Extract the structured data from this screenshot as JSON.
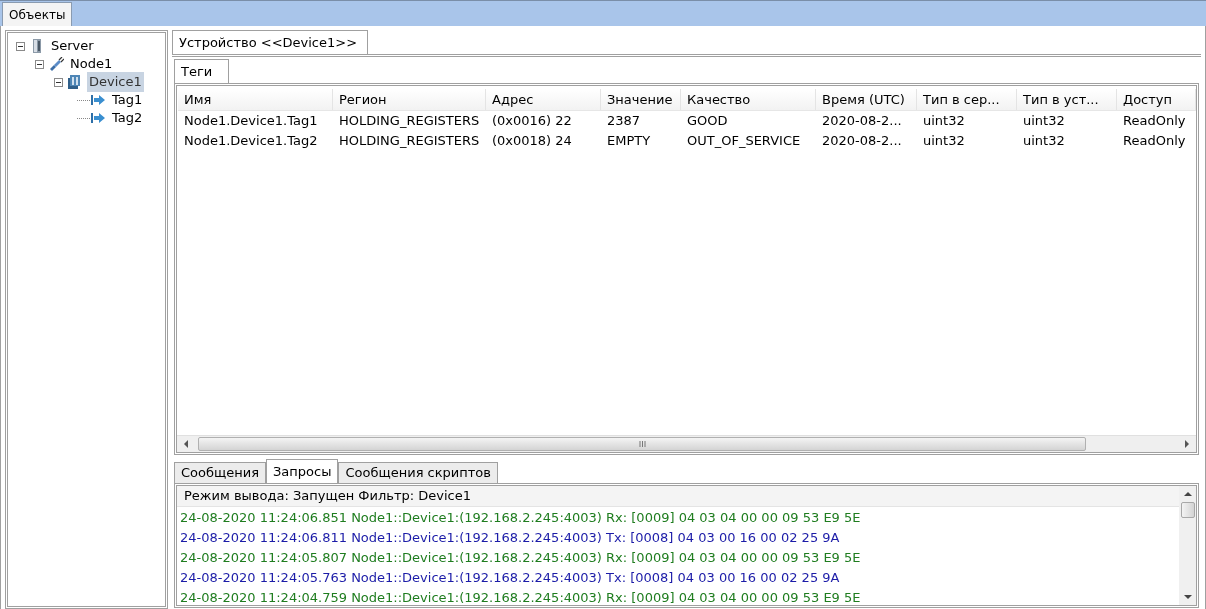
{
  "tabs": [
    {
      "label": "Объекты",
      "selected": true
    }
  ],
  "tree": [
    {
      "label": "Server",
      "kind": "server",
      "expanded": true,
      "selected": false,
      "children": [
        {
          "label": "Node1",
          "kind": "node",
          "expanded": true,
          "selected": false,
          "children": [
            {
              "label": "Device1",
              "kind": "device",
              "expanded": true,
              "selected": true,
              "children": [
                {
                  "label": "Tag1",
                  "kind": "tag",
                  "selected": false
                },
                {
                  "label": "Tag2",
                  "kind": "tag",
                  "selected": false
                }
              ]
            }
          ]
        }
      ]
    }
  ],
  "document_tabs": [
    {
      "label": "Устройство <<Device1>>",
      "selected": true
    }
  ],
  "inner_tabs": [
    {
      "label": "Теги",
      "selected": true
    }
  ],
  "table": {
    "columns": [
      "Имя",
      "Регион",
      "Адрес",
      "Значение",
      "Качество",
      "Время (UTC)",
      "Тип в сер...",
      "Тип в уст...",
      "Доступ"
    ],
    "rows": [
      [
        "Node1.Device1.Tag1",
        "HOLDING_REGISTERS",
        "(0x0016) 22",
        "2387",
        "GOOD",
        "2020-08-2...",
        "uint32",
        "uint32",
        "ReadOnly"
      ],
      [
        "Node1.Device1.Tag2",
        "HOLDING_REGISTERS",
        "(0x0018) 24",
        "EMPTY",
        "OUT_OF_SERVICE",
        "2020-08-2...",
        "uint32",
        "uint32",
        "ReadOnly"
      ]
    ]
  },
  "log_tabs": [
    {
      "label": "Сообщения",
      "selected": false
    },
    {
      "label": "Запросы",
      "selected": true
    },
    {
      "label": "Сообщения скриптов",
      "selected": false
    }
  ],
  "log": {
    "header": "Режим вывода: Запущен Фильтр: Device1",
    "lines": [
      {
        "kind": "rx",
        "text": "24-08-2020 11:24:06.851 Node1::Device1:(192.168.2.245:4003) Rx: [0009] 04 03 04 00 00 09 53 E9 5E"
      },
      {
        "kind": "tx",
        "text": "24-08-2020 11:24:06.811 Node1::Device1:(192.168.2.245:4003) Tx: [0008] 04 03 00 16 00 02 25 9A"
      },
      {
        "kind": "rx",
        "text": "24-08-2020 11:24:05.807 Node1::Device1:(192.168.2.245:4003) Rx: [0009] 04 03 04 00 00 09 53 E9 5E"
      },
      {
        "kind": "tx",
        "text": "24-08-2020 11:24:05.763 Node1::Device1:(192.168.2.245:4003) Tx: [0008] 04 03 00 16 00 02 25 9A"
      },
      {
        "kind": "rx",
        "text": "24-08-2020 11:24:04.759 Node1::Device1:(192.168.2.245:4003) Rx: [0009] 04 03 04 00 00 09 53 E9 5E"
      }
    ]
  }
}
